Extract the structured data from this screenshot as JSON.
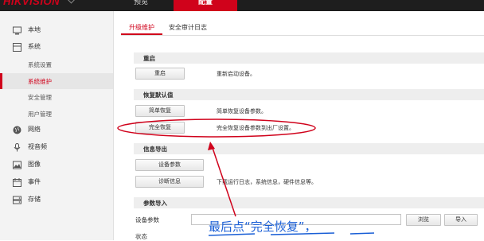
{
  "header": {
    "logo_text": "HIKVISION",
    "nav": [
      {
        "label": "预览"
      },
      {
        "label": "配置"
      }
    ]
  },
  "sidebar": {
    "items": [
      {
        "label": "本地",
        "icon": "monitor-icon"
      },
      {
        "label": "系统",
        "icon": "system-icon"
      },
      {
        "label": "系统设置",
        "sub": true
      },
      {
        "label": "系统维护",
        "sub": true,
        "active": true
      },
      {
        "label": "安全管理",
        "sub": true
      },
      {
        "label": "用户管理",
        "sub": true
      },
      {
        "label": "网络",
        "icon": "globe-icon"
      },
      {
        "label": "视音频",
        "icon": "mic-icon"
      },
      {
        "label": "图像",
        "icon": "image-icon"
      },
      {
        "label": "事件",
        "icon": "calendar-icon"
      },
      {
        "label": "存储",
        "icon": "storage-icon"
      }
    ]
  },
  "tabs": [
    {
      "label": "升级维护",
      "active": true
    },
    {
      "label": "安全审计日志"
    }
  ],
  "sections": {
    "reboot": {
      "title": "重启",
      "button": "重启",
      "desc": "重新启动设备。"
    },
    "restore": {
      "title": "恢复默认值",
      "simple_button": "简单恢复",
      "simple_desc": "简单恢复设备参数。",
      "full_button": "完全恢复",
      "full_desc": "完全恢复设备参数到出厂设置。"
    },
    "export": {
      "title": "信息导出",
      "params_button": "设备参数",
      "diag_button": "诊断信息",
      "diag_desc": "下载运行日志，系统信息，硬件信息等。"
    },
    "import": {
      "title": "参数导入",
      "field_label": "设备参数",
      "browse_button": "浏览",
      "import_button": "导入",
      "status_label": "状态"
    }
  },
  "annotation": {
    "text": "最后点“完全恢复”，",
    "color": "#1a5fd6",
    "highlight_color": "#d0021b"
  }
}
